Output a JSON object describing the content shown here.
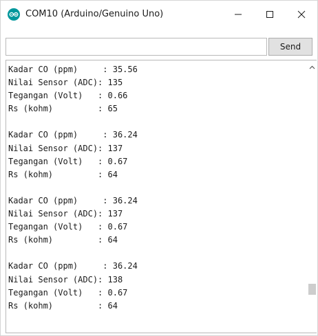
{
  "window": {
    "title": "COM10 (Arduino/Genuino Uno)"
  },
  "icons": {
    "app": "arduino-logo-icon",
    "minimize": "minimize-icon",
    "maximize": "maximize-icon",
    "close": "close-icon",
    "scroll_up": "chevron-up-icon"
  },
  "colors": {
    "arduino_teal": "#00979c"
  },
  "toolbar": {
    "input_value": "",
    "send_label": "Send"
  },
  "output": {
    "lines": [
      "Kadar CO (ppm)     : 35.56",
      "Nilai Sensor (ADC): 135",
      "Tegangan (Volt)   : 0.66",
      "Rs (kohm)         : 65",
      "",
      "Kadar CO (ppm)     : 36.24",
      "Nilai Sensor (ADC): 137",
      "Tegangan (Volt)   : 0.67",
      "Rs (kohm)         : 64",
      "",
      "Kadar CO (ppm)     : 36.24",
      "Nilai Sensor (ADC): 137",
      "Tegangan (Volt)   : 0.67",
      "Rs (kohm)         : 64",
      "",
      "Kadar CO (ppm)     : 36.24",
      "Nilai Sensor (ADC): 138",
      "Tegangan (Volt)   : 0.67",
      "Rs (kohm)         : 64"
    ]
  }
}
